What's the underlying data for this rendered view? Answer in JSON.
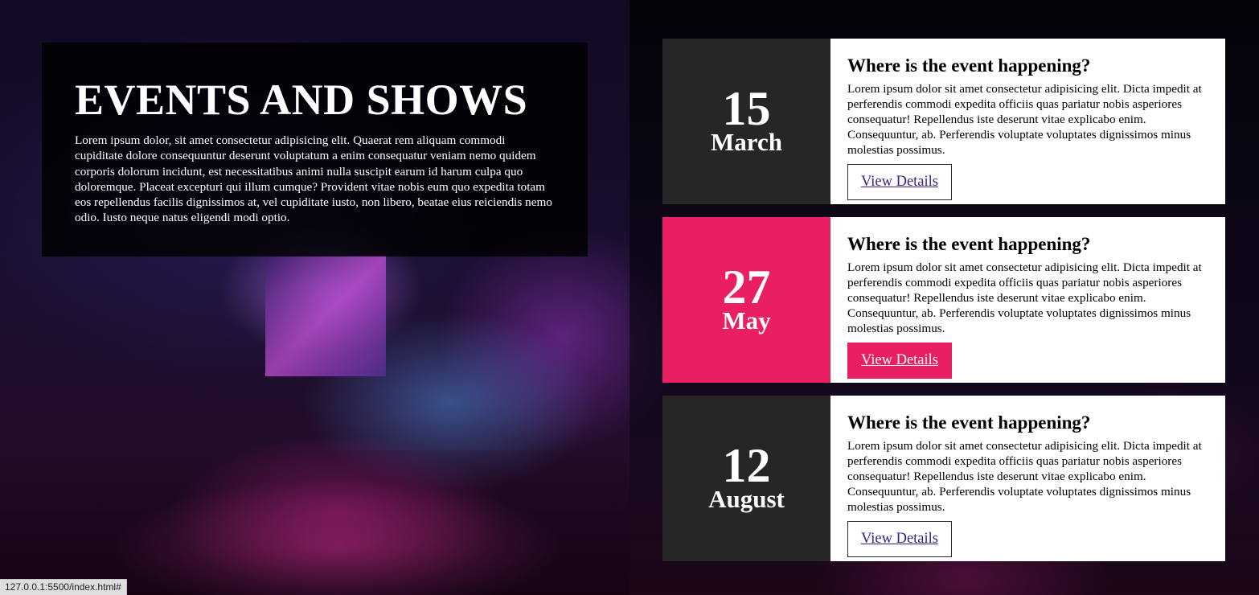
{
  "hero": {
    "title": "EVENTS AND SHOWS",
    "body": "Lorem ipsum dolor, sit amet consectetur adipisicing elit. Quaerat rem aliquam commodi cupiditate dolore consequuntur deserunt voluptatum a enim consequatur veniam nemo quidem corporis dolorum incidunt, est necessitatibus animi nulla suscipit earum id harum culpa quo doloremque. Placeat excepturi qui illum cumque? Provident vitae nobis eum quo expedita totam eos repellendus facilis dignissimos at, vel cupiditate iusto, non libero, beatae eius reiciendis nemo odio. Iusto neque natus eligendi modi optio."
  },
  "events": [
    {
      "day": "15",
      "month": "March",
      "heading": "Where is the event happening?",
      "description": "Lorem ipsum dolor sit amet consectetur adipisicing elit. Dicta impedit at perferendis commodi expedita officiis quas pariatur nobis asperiores consequatur! Repellendus iste deserunt vitae explicabo enim. Consequuntur, ab. Perferendis voluptate voluptates dignissimos minus molestias possimus.",
      "button": "View Details",
      "date_color": "#262626"
    },
    {
      "day": "27",
      "month": "May",
      "heading": "Where is the event happening?",
      "description": "Lorem ipsum dolor sit amet consectetur adipisicing elit. Dicta impedit at perferendis commodi expedita officiis quas pariatur nobis asperiores consequatur! Repellendus iste deserunt vitae explicabo enim. Consequuntur, ab. Perferendis voluptate voluptates dignissimos minus molestias possimus.",
      "button": "View Details",
      "date_color": "#e91e63"
    },
    {
      "day": "12",
      "month": "August",
      "heading": "Where is the event happening?",
      "description": "Lorem ipsum dolor sit amet consectetur adipisicing elit. Dicta impedit at perferendis commodi expedita officiis quas pariatur nobis asperiores consequatur! Repellendus iste deserunt vitae explicabo enim. Consequuntur, ab. Perferendis voluptate voluptates dignissimos minus molestias possimus.",
      "button": "View Details",
      "date_color": "#262626"
    }
  ],
  "colors": {
    "accent": "#e91e63",
    "dark": "#262626",
    "link_text": "#3a1f86"
  },
  "statusbar": {
    "url": "127.0.0.1:5500/index.html#"
  }
}
